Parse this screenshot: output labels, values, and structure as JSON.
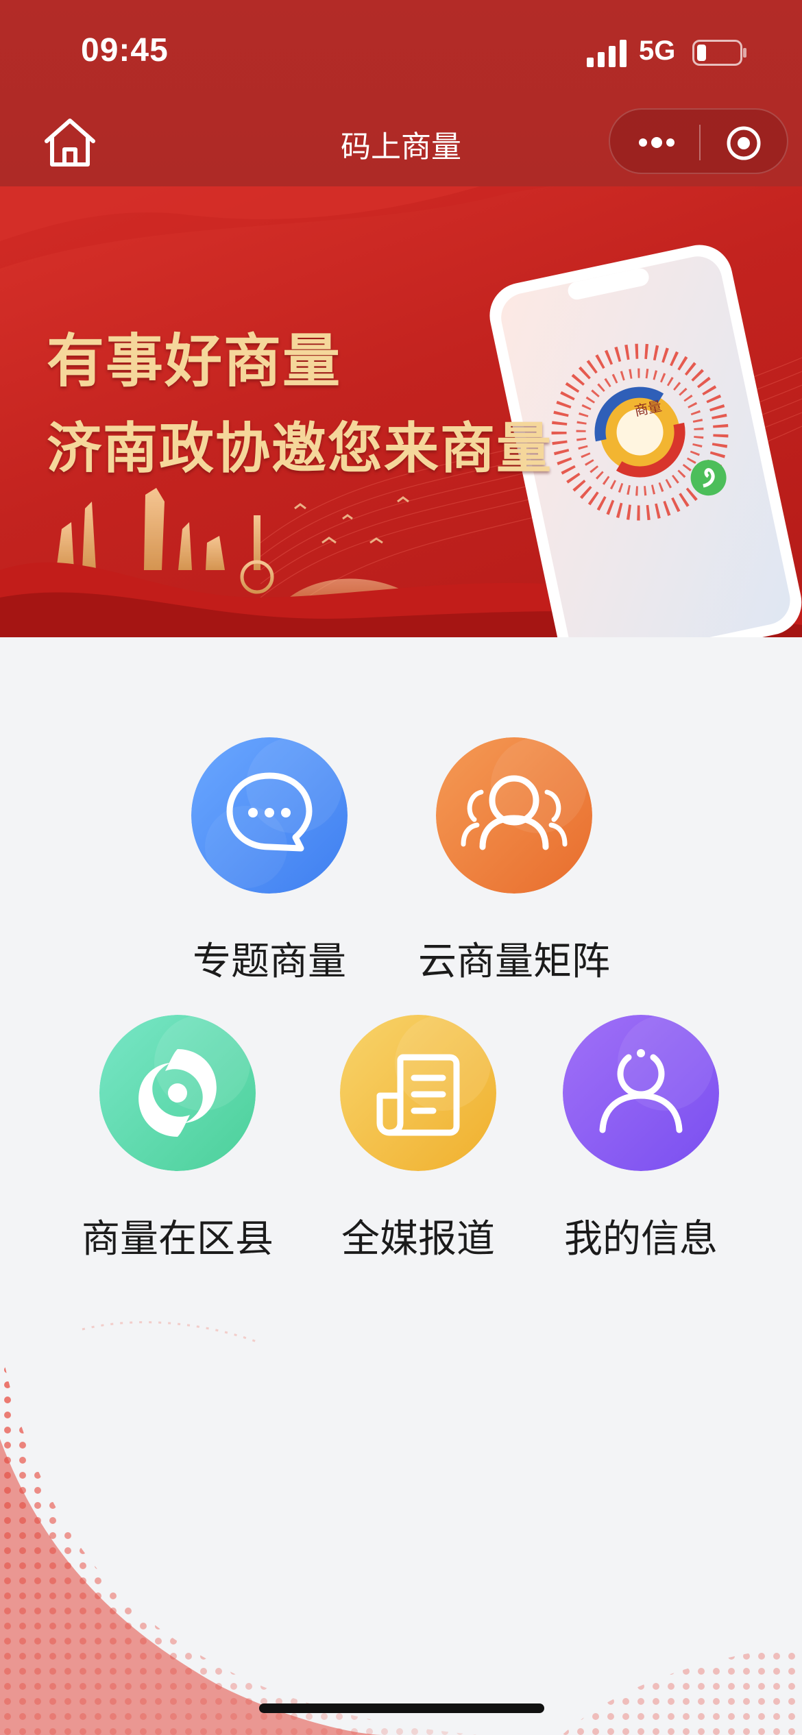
{
  "status_bar": {
    "time": "09:45",
    "network": "5G"
  },
  "nav": {
    "title": "码上商量"
  },
  "banner": {
    "line1": "有事好商量",
    "line2": "济南政协邀您来商量",
    "qr_badge_text": "商量"
  },
  "menu": [
    {
      "label": "专题商量",
      "icon": "chat-bubble-icon",
      "color": "#4f8ef4"
    },
    {
      "label": "云商量矩阵",
      "icon": "group-people-icon",
      "color": "#ee7d3c"
    },
    {
      "label": "商量在区县",
      "icon": "swirl-icon",
      "color": "#5fdcb4"
    },
    {
      "label": "全媒报道",
      "icon": "news-document-icon",
      "color": "#f4c243"
    },
    {
      "label": "我的信息",
      "icon": "user-profile-icon",
      "color": "#8d5cf3"
    }
  ]
}
